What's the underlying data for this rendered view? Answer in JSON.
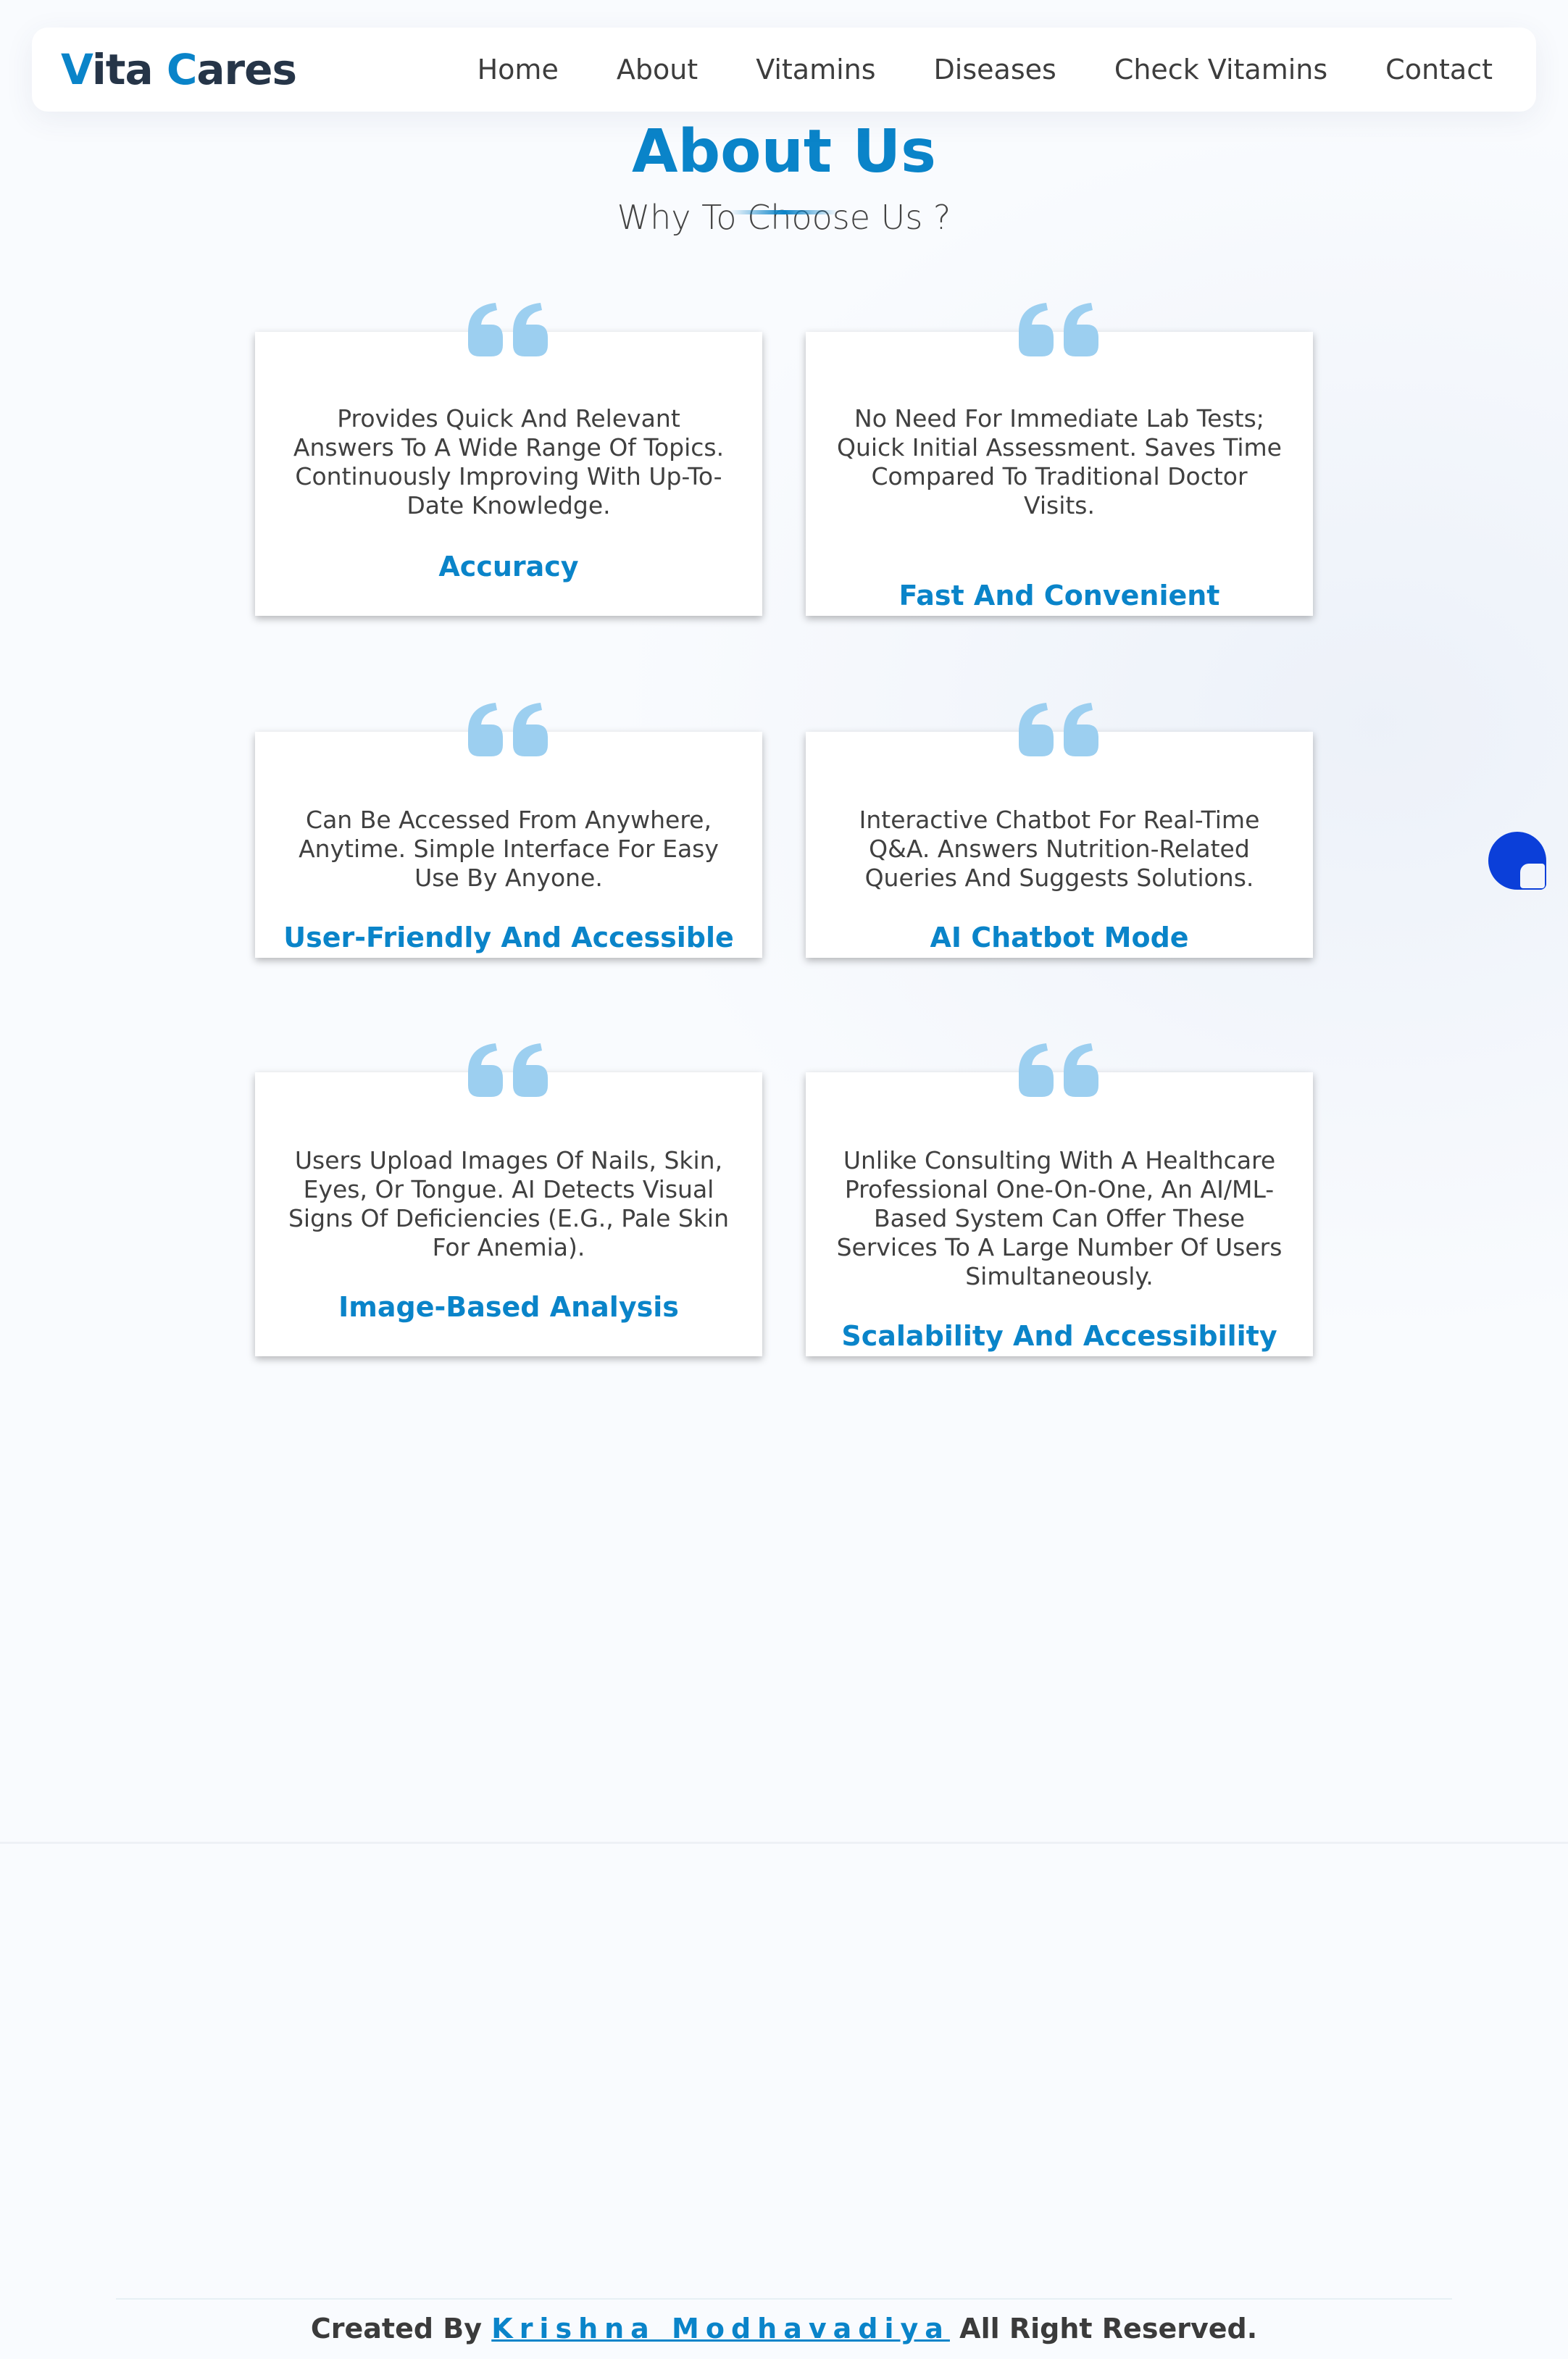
{
  "header": {
    "logo_part1_first": "V",
    "logo_part1_rest": "ita ",
    "logo_part2_first": "C",
    "logo_part2_rest": "ares",
    "nav": [
      "Home",
      "About",
      "Vitamins",
      "Diseases",
      "Check Vitamins",
      "Contact"
    ]
  },
  "main": {
    "title": "About Us",
    "subtitle": "Why To Choose Us ?",
    "cards": [
      {
        "text": "Provides Quick And Relevant Answers To A Wide Range Of Topics. Continuously Improving With Up-To-Date Knowledge.",
        "title": "Accuracy"
      },
      {
        "text": "No Need For Immediate Lab Tests; Quick Initial Assessment. Saves Time Compared To Traditional Doctor Visits.",
        "title": "Fast And Convenient"
      },
      {
        "text": "Can Be Accessed From Anywhere, Anytime. Simple Interface For Easy Use By Anyone.",
        "title": "User-Friendly And Accessible"
      },
      {
        "text": "Interactive Chatbot For Real-Time Q&A. Answers Nutrition-Related Queries And Suggests Solutions.",
        "title": "AI Chatbot Mode"
      },
      {
        "text": "Users Upload Images Of Nails, Skin, Eyes, Or Tongue. AI Detects Visual Signs Of Deficiencies (E.G., Pale Skin For Anemia).",
        "title": "Image-Based Analysis"
      },
      {
        "text": "Unlike Consulting With A Healthcare Professional One-On-One, An AI/ML-Based System Can Offer These Services To A Large Number Of Users Simultaneously.",
        "title": "Scalability And Accessibility"
      }
    ]
  },
  "footer": {
    "prefix": "Created By",
    "author": "Krishna Modhavadiya",
    "suffix": "All Right Reserved."
  },
  "colors": {
    "accent": "#0a84c9",
    "quote_icon": "#9ccff0",
    "chat_button": "#0b3fd9"
  }
}
